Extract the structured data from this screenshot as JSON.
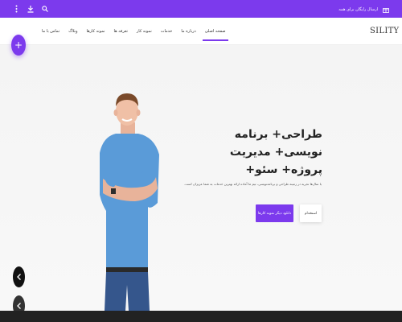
{
  "topbar": {
    "promo_text": "ارسال رایگان برای همه",
    "icons": [
      "search-icon",
      "download-icon",
      "more-vertical-icon"
    ],
    "promo_icon": "gift-icon",
    "color": "#7c3aed"
  },
  "header": {
    "logo": "SILITY",
    "menu": [
      {
        "label": "صفحه اصلی",
        "active": true
      },
      {
        "label": "درباره ما",
        "active": false
      },
      {
        "label": "خدمات",
        "active": false
      },
      {
        "label": "نمونه کار",
        "active": false
      },
      {
        "label": "تعرفه ها",
        "active": false
      },
      {
        "label": "نمونه کارها",
        "active": false
      },
      {
        "label": "وبلاگ",
        "active": false
      },
      {
        "label": "تماس با ما",
        "active": false
      }
    ]
  },
  "hero": {
    "headline_line1": "طراحی+ برنامه نویسی+ مدیریت",
    "headline_line2": "پروژه+ سئو+",
    "subtext": "با سال‌ها تجربه در زمینه طراحی و برنامه‌نویسی، تیم ما آماده ارائه بهترین خدمات به شما عزیزان است.",
    "primary_button": "دانلود دیگر نمونه کارها",
    "secondary_button": "استخدام",
    "accent_color": "#7c3aed"
  },
  "fab_icon": "plus-icon",
  "arrows": [
    "chevron-left-icon",
    "chevron-left-icon"
  ]
}
